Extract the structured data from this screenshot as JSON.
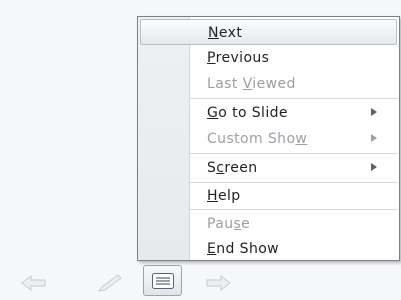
{
  "menu": {
    "items": [
      {
        "pre": "",
        "key": "N",
        "post": "ext",
        "disabled": false,
        "submenu": false,
        "hover": true
      },
      {
        "pre": "",
        "key": "P",
        "post": "revious",
        "disabled": false,
        "submenu": false
      },
      {
        "pre": "Last ",
        "key": "V",
        "post": "iewed",
        "disabled": true,
        "submenu": false
      },
      {
        "pre": "",
        "key": "G",
        "post": "o to Slide",
        "disabled": false,
        "submenu": true
      },
      {
        "pre": "Custom Sho",
        "key": "w",
        "post": "",
        "disabled": true,
        "submenu": true
      },
      {
        "pre": "S",
        "key": "c",
        "post": "reen",
        "disabled": false,
        "submenu": true
      },
      {
        "pre": "",
        "key": "H",
        "post": "elp",
        "disabled": false,
        "submenu": false
      },
      {
        "pre": "Pau",
        "key": "s",
        "post": "e",
        "disabled": true,
        "submenu": false
      },
      {
        "pre": "",
        "key": "E",
        "post": "nd Show",
        "disabled": false,
        "submenu": false
      }
    ]
  },
  "toolbar": {
    "icons": [
      "previous-arrow-icon",
      "pen-icon",
      "menu-icon",
      "next-arrow-icon"
    ]
  }
}
